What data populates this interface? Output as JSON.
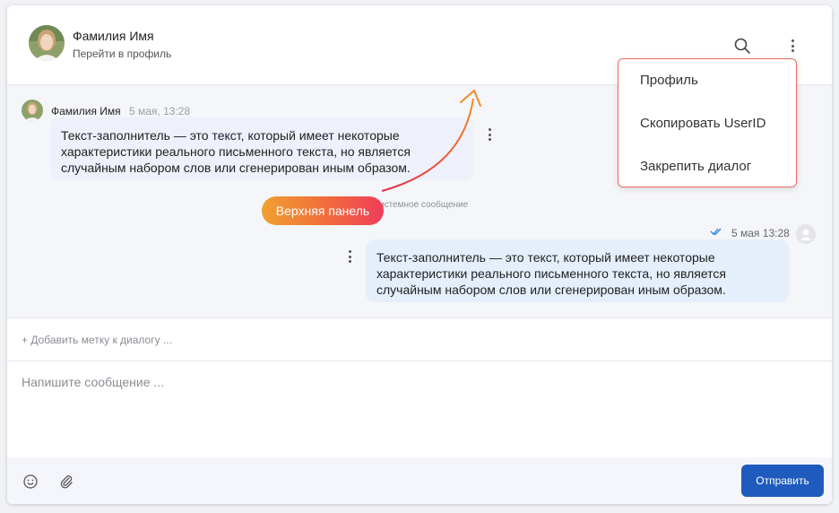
{
  "header": {
    "contact_name": "Фамилия Имя",
    "profile_link": "Перейти в профиль"
  },
  "messages": [
    {
      "direction": "incoming",
      "author": "Фамилия Имя",
      "time": "5 мая, 13:28",
      "text": "Текст-заполнитель — это текст, который имеет некоторые характеристики реального письменного текста, но является случайным набором слов или сгенерирован иным образом."
    },
    {
      "direction": "outgoing",
      "time": "5 мая 13:28",
      "status": "read",
      "text": "Текст-заполнитель — это текст, который имеет некоторые характеристики реального письменного текста, но является случайным набором слов или сгенерирован иным образом."
    }
  ],
  "system_message": "истемное сообщение",
  "tag_row": {
    "add_label": "+ Добавить метку к диалогу ..."
  },
  "composer": {
    "placeholder": "Напишите сообщение ..."
  },
  "footer": {
    "send_label": "Отправить"
  },
  "dropdown_menu": {
    "items": [
      "Профиль",
      "Скопировать UserID",
      "Закрепить диалог"
    ]
  },
  "annotation": {
    "label": "Верхняя панель"
  },
  "colors": {
    "send_button": "#1e5bbd",
    "incoming_bubble": "#eef0fb",
    "outgoing_bubble": "#e4effb",
    "read_check": "#2f7de1",
    "annotation_gradient_start": "#f0a030",
    "annotation_gradient_end": "#ef3d5a"
  }
}
